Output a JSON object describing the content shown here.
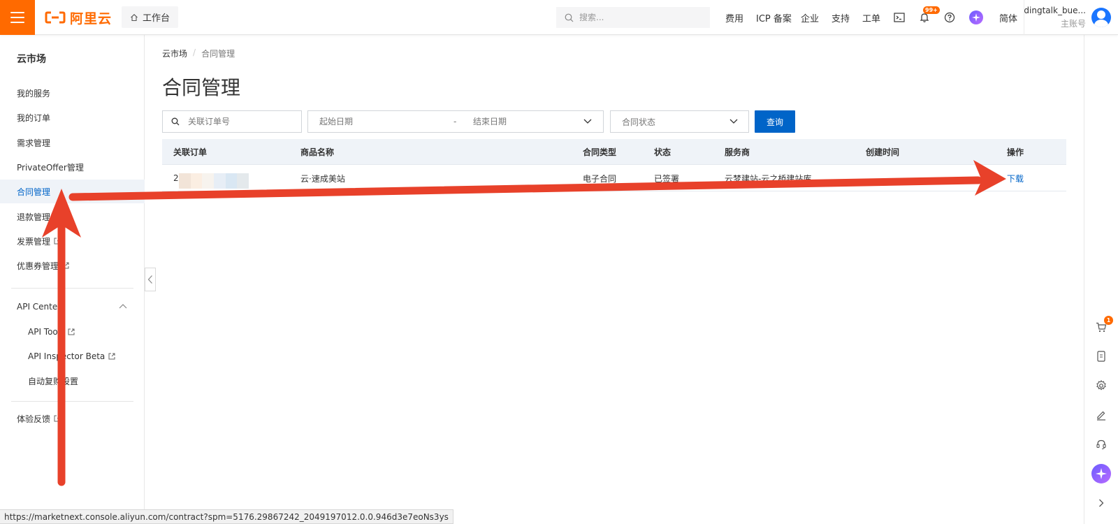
{
  "header": {
    "brand": "阿里云",
    "workbench_label": "工作台",
    "search_placeholder": "搜索...",
    "nav": [
      "费用",
      "ICP 备案",
      "企业",
      "支持",
      "工单"
    ],
    "notification_badge": "99+",
    "language": "简体",
    "account_name": "dingtalk_bue...",
    "account_role": "主账号"
  },
  "sidebar": {
    "title": "云市场",
    "items": [
      {
        "label": "我的服务"
      },
      {
        "label": "我的订单"
      },
      {
        "label": "需求管理"
      },
      {
        "label": "PrivateOffer管理"
      },
      {
        "label": "合同管理"
      },
      {
        "label": "退款管理"
      },
      {
        "label": "发票管理"
      },
      {
        "label": "优惠券管理"
      }
    ],
    "api_center": "API Center",
    "api_items": [
      {
        "label": "API Tools"
      },
      {
        "label": "API Inspector Beta"
      },
      {
        "label": "自动复购设置"
      }
    ],
    "feedback": "体验反馈"
  },
  "main": {
    "breadcrumb": [
      "云市场",
      "合同管理"
    ],
    "title": "合同管理",
    "filters": {
      "order_placeholder": "关联订单号",
      "start_date_placeholder": "起始日期",
      "date_separator": "-",
      "end_date_placeholder": "结束日期",
      "status_placeholder": "合同状态",
      "query_button": "查询"
    },
    "table": {
      "columns": [
        "关联订单",
        "商品名称",
        "合同类型",
        "状态",
        "服务商",
        "创建时间",
        "操作"
      ],
      "rows": [
        {
          "order": "2",
          "product": "云·速成美站",
          "type": "电子合同",
          "status": "已签署",
          "provider": "云梦建站-云之桥建站库",
          "created": "",
          "action": "下载"
        }
      ]
    }
  },
  "right_rail": {
    "cart_badge": "1"
  },
  "status_url": "https://marketnext.console.aliyun.com/contract?spm=5176.29867242_2049197012.0.0.946d3e7eoNs3ys",
  "colors": {
    "brand_orange": "#ff6a00",
    "primary_blue": "#0064c8",
    "annotation_red": "#e8412a",
    "table_header_bg": "#eff3f8"
  }
}
